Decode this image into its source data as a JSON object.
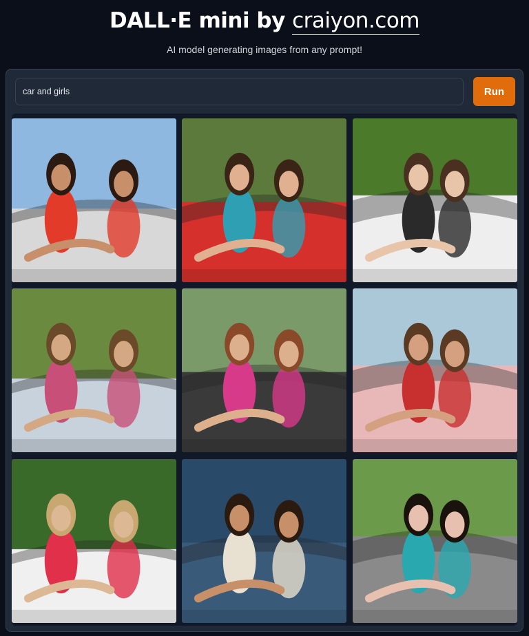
{
  "header": {
    "title_prefix": "DALL·E mini by ",
    "title_domain": "craiyon.com",
    "subtitle": "AI model generating images from any prompt!"
  },
  "prompt": {
    "value": "car and girls"
  },
  "run_button": {
    "label": "Run"
  },
  "gallery": {
    "images": [
      {
        "name": "generated-image-1",
        "sky": "#8fb8e0",
        "car": "#d8d8d8",
        "accent": "#e23b2a",
        "skin": "#c8906a",
        "hair": "#2a1a12"
      },
      {
        "name": "generated-image-2",
        "sky": "#5c7a3c",
        "car": "#d6302c",
        "accent": "#2fa0b4",
        "skin": "#e0b090",
        "hair": "#3a2416"
      },
      {
        "name": "generated-image-3",
        "sky": "#4a7a2a",
        "car": "#eeeeee",
        "accent": "#2a2a2a",
        "skin": "#e8c4a8",
        "hair": "#4a3020"
      },
      {
        "name": "generated-image-4",
        "sky": "#6a8a40",
        "car": "#c8d2dc",
        "accent": "#c85078",
        "skin": "#d4a882",
        "hair": "#6a4a28"
      },
      {
        "name": "generated-image-5",
        "sky": "#7a9a6a",
        "car": "#3a3a3a",
        "accent": "#d83a8a",
        "skin": "#dcb08c",
        "hair": "#8a4a2a"
      },
      {
        "name": "generated-image-6",
        "sky": "#aac8d8",
        "car": "#e8b8b8",
        "accent": "#c83030",
        "skin": "#d4a080",
        "hair": "#5a3a22"
      },
      {
        "name": "generated-image-7",
        "sky": "#3a6a2a",
        "car": "#f0f0f0",
        "accent": "#e0304a",
        "skin": "#ddb894",
        "hair": "#c8a870"
      },
      {
        "name": "generated-image-8",
        "sky": "#2a4a6a",
        "car": "#3a5a7a",
        "accent": "#e8e0d0",
        "skin": "#c89068",
        "hair": "#2a1a10"
      },
      {
        "name": "generated-image-9",
        "sky": "#6a9a4a",
        "car": "#8a8a8a",
        "accent": "#2aa8b0",
        "skin": "#e8c0b0",
        "hair": "#1a120c"
      }
    ]
  }
}
